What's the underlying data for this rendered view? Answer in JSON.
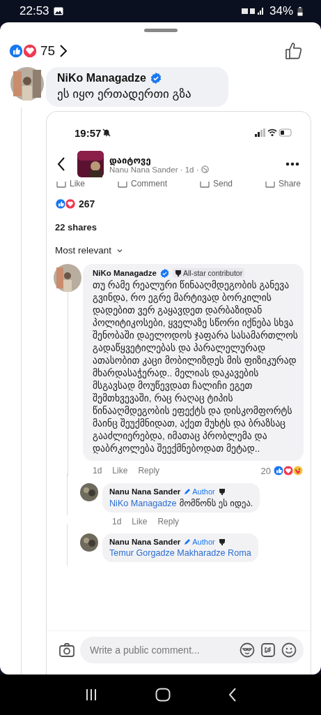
{
  "status_bar": {
    "time": "22:53",
    "battery": "34%"
  },
  "reactions": {
    "count": "75"
  },
  "comment": {
    "author": "NiKo Managadze",
    "verified": true,
    "text": "ეს იყო ერთადერთი გზა"
  },
  "shared_screenshot": {
    "status_time": "19:57",
    "page_name": "დაიტოვე",
    "subtitle": "Nanu Nana Sander · 1d ·",
    "actions": [
      "Like",
      "Comment",
      "Send",
      "Share"
    ],
    "reaction_count": "267",
    "shares": "22 shares",
    "sort": "Most relevant",
    "comments": [
      {
        "kind": "comment",
        "author": "NiKo Managadze",
        "verified": true,
        "badge": "All-star contributor",
        "text": "თუ რამე რეალური წინააღმდეგობის განევა გვინდა, რო ეგრე მარტივად ბორკილის დადებით ვერ გაყავდეთ დარბაზიდან პოლიტიკოსები, ყველაზე სწორი იქნება სხვა შენობაში დაელოდოს ჯაფარა სასამართლოს გადაწყვეტილებას და პარალელურად ათასობით კაცი მობილიზდეს მის ფიზიკურად მხარდასაჭერად.. მელიას დაკავების მსგავსად მოუწევდათ ჩალიჩი ეგეთ შემთხვევაში, რაც რაღაც ტიპის წინააღმდეგობის ეფექტს და დისკომფორტს მაინც შეუქმნიდათ, აქეთ მუხტს და ბრაზსაც გააძლიერებდა, იმათაც პრობლემა და დაბრკოლება შეექმნებოდათ მეტად..",
        "time": "1d",
        "like": "Like",
        "reply": "Reply",
        "reaction_count": "20"
      },
      {
        "kind": "reply",
        "author": "Nanu Nana Sander",
        "badge": "Author",
        "mention": "NiKo Managadze",
        "text": "მომწონს ეს იდეა.",
        "time": "1d",
        "like": "Like",
        "reply": "Reply"
      },
      {
        "kind": "reply",
        "author": "Nanu Nana Sander",
        "badge": "Author",
        "mention": "Temur Gorgadze Makharadze Roma"
      }
    ],
    "composer": {
      "placeholder": "Write a public comment..."
    }
  }
}
